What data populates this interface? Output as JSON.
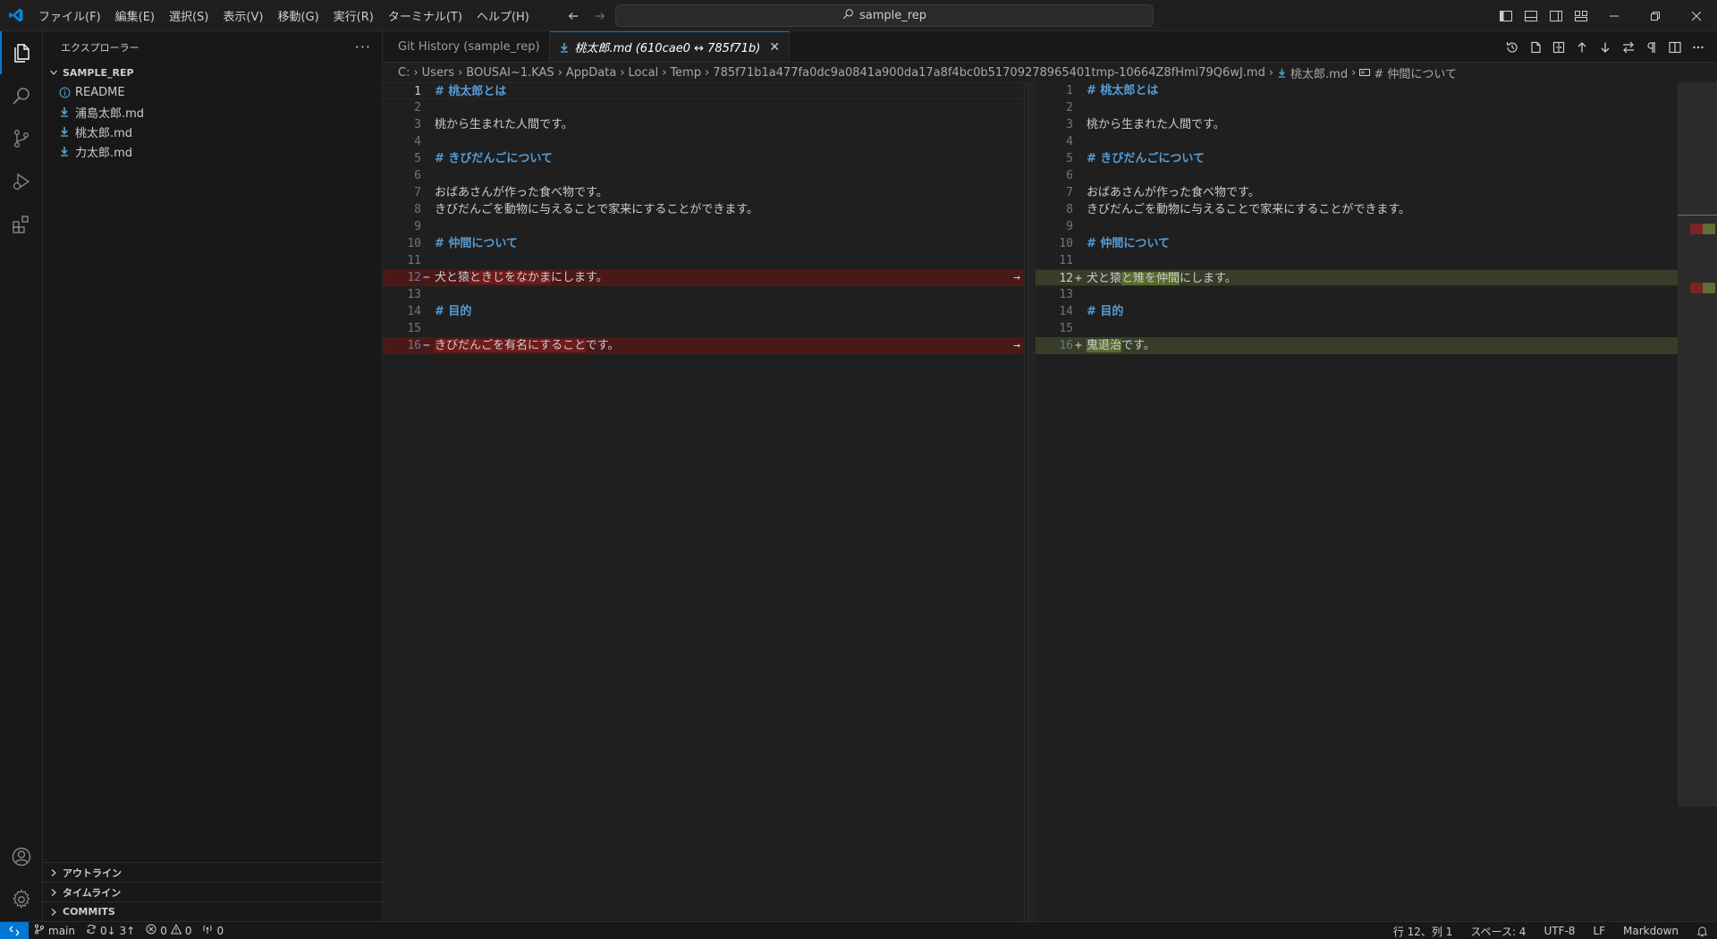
{
  "titlebar": {
    "menus": [
      "ファイル(F)",
      "編集(E)",
      "選択(S)",
      "表示(V)",
      "移動(G)",
      "実行(R)",
      "ターミナル(T)",
      "ヘルプ(H)"
    ],
    "search": "sample_rep"
  },
  "sidebar": {
    "title": "エクスプローラー",
    "more": "···",
    "folder": "SAMPLE_REP",
    "files": [
      {
        "name": "README",
        "icon": "info-icon"
      },
      {
        "name": "浦島太郎.md",
        "icon": "markdown-icon"
      },
      {
        "name": "桃太郎.md",
        "icon": "markdown-icon"
      },
      {
        "name": "力太郎.md",
        "icon": "markdown-icon"
      }
    ],
    "sections": [
      "アウトライン",
      "タイムライン",
      "COMMITS"
    ]
  },
  "tabs": [
    {
      "label": "Git History (sample_rep)",
      "active": false
    },
    {
      "label": "桃太郎.md (610cae0 ↔ 785f71b)",
      "active": true
    }
  ],
  "breadcrumbs": [
    "C:",
    "Users",
    "BOUSAI~1.KAS",
    "AppData",
    "Local",
    "Temp",
    "785f71b1a477fa0dc9a0841a900da17a8f4bc0b51709278965401tmp-10664Z8fHmi79Q6wJ.md",
    "桃太郎.md",
    "# 仲間について"
  ],
  "diff": {
    "left": [
      {
        "n": "1",
        "text": "# 桃太郎とは",
        "type": "heading",
        "cur": true
      },
      {
        "n": "2",
        "text": ""
      },
      {
        "n": "3",
        "text": "桃から生まれた人間です。"
      },
      {
        "n": "4",
        "text": ""
      },
      {
        "n": "5",
        "text": "# きびだんごについて",
        "type": "heading"
      },
      {
        "n": "6",
        "text": ""
      },
      {
        "n": "7",
        "text": "おばあさんが作った食べ物です。"
      },
      {
        "n": "8",
        "text": "きびだんごを動物に与えることで家来にすることができます。"
      },
      {
        "n": "9",
        "text": ""
      },
      {
        "n": "10",
        "text": "# 仲間について",
        "type": "heading"
      },
      {
        "n": "11",
        "text": ""
      },
      {
        "n": "12",
        "text": "犬と猿ときじをなかまにします。",
        "type": "del",
        "mark": "−",
        "hl": "ときじをなかま",
        "pre": "犬と猿",
        "post": "にします。"
      },
      {
        "n": "13",
        "text": ""
      },
      {
        "n": "14",
        "text": "# 目的",
        "type": "heading"
      },
      {
        "n": "15",
        "text": ""
      },
      {
        "n": "16",
        "text": "きびだんごを有名にすることです。",
        "type": "del",
        "mark": "−",
        "hl": "きびだんごを有名にすること",
        "pre": "",
        "post": "です。"
      }
    ],
    "right": [
      {
        "n": "1",
        "text": "# 桃太郎とは",
        "type": "heading"
      },
      {
        "n": "2",
        "text": ""
      },
      {
        "n": "3",
        "text": "桃から生まれた人間です。"
      },
      {
        "n": "4",
        "text": ""
      },
      {
        "n": "5",
        "text": "# きびだんごについて",
        "type": "heading"
      },
      {
        "n": "6",
        "text": ""
      },
      {
        "n": "7",
        "text": "おばあさんが作った食べ物です。"
      },
      {
        "n": "8",
        "text": "きびだんごを動物に与えることで家来にすることができます。"
      },
      {
        "n": "9",
        "text": ""
      },
      {
        "n": "10",
        "text": "# 仲間について",
        "type": "heading"
      },
      {
        "n": "11",
        "text": ""
      },
      {
        "n": "12",
        "text": "犬と猿と雉を仲間にします。",
        "type": "add",
        "mark": "+",
        "hl": "と雉を仲間",
        "pre": "犬と猿",
        "post": "にします。",
        "cur": true
      },
      {
        "n": "13",
        "text": ""
      },
      {
        "n": "14",
        "text": "# 目的",
        "type": "heading"
      },
      {
        "n": "15",
        "text": ""
      },
      {
        "n": "16",
        "text": "鬼退治です。",
        "type": "add",
        "mark": "+",
        "hl": "鬼退治",
        "pre": "",
        "post": "です。"
      }
    ],
    "revert_symbol": "→"
  },
  "statusbar": {
    "branch": "main",
    "sync": "0↓ 3↑",
    "errors": "0",
    "warnings": "0",
    "ports": "0",
    "position": "行 12、列 1",
    "spaces": "スペース: 4",
    "encoding": "UTF-8",
    "eol": "LF",
    "language": "Markdown"
  },
  "colors": {
    "accent": "#0078d4",
    "deleted_line": "#4b1818",
    "inserted_line": "#373d29",
    "heading": "#569cd6"
  }
}
